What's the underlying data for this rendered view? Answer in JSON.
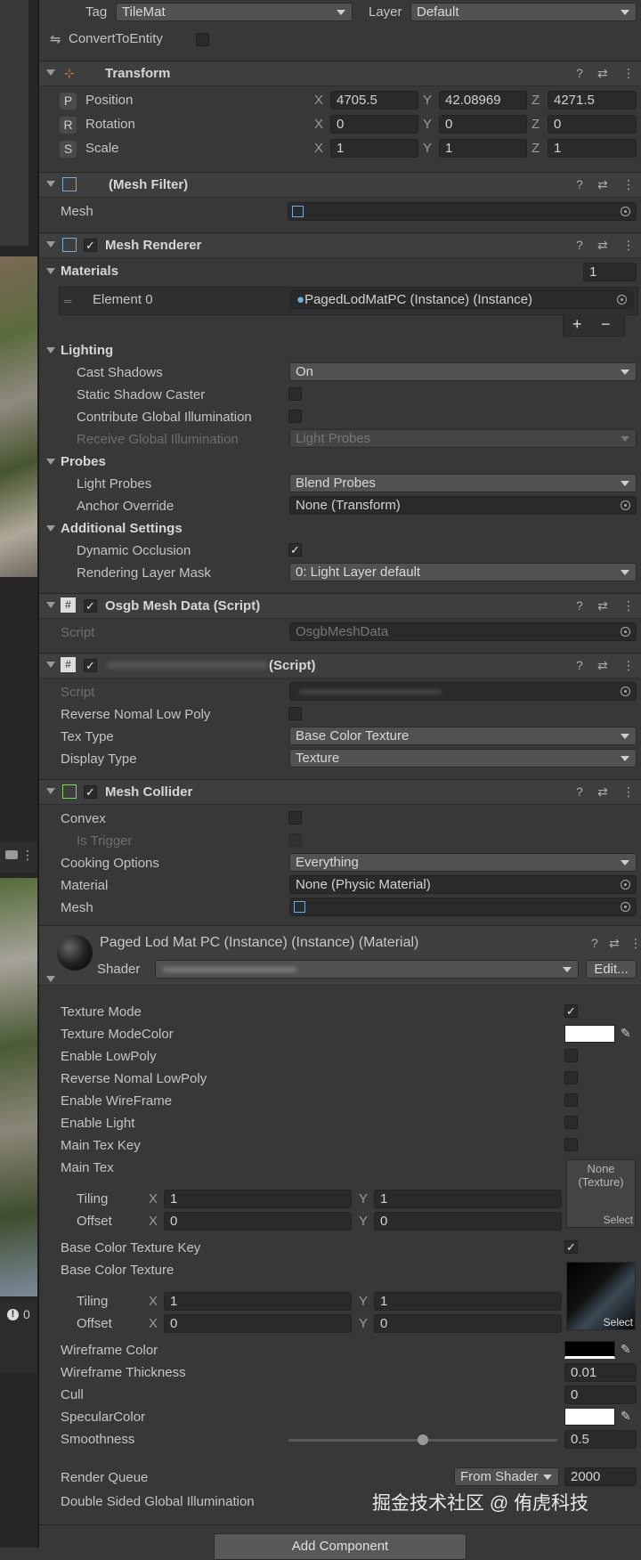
{
  "top": {
    "tag_label": "Tag",
    "tag_value": "TileMat",
    "layer_label": "Layer",
    "layer_value": "Default",
    "convert_label": "ConvertToEntity"
  },
  "transform": {
    "title": "Transform",
    "rows": [
      {
        "badge": "P",
        "label": "Position",
        "x": "4705.5",
        "y": "42.08969",
        "z": "4271.5"
      },
      {
        "badge": "R",
        "label": "Rotation",
        "x": "0",
        "y": "0",
        "z": "0"
      },
      {
        "badge": "S",
        "label": "Scale",
        "x": "1",
        "y": "1",
        "z": "1"
      }
    ],
    "axis": {
      "x": "X",
      "y": "Y",
      "z": "Z"
    }
  },
  "mesh_filter": {
    "title": "(Mesh Filter)",
    "mesh_label": "Mesh"
  },
  "mesh_renderer": {
    "title": "Mesh Renderer",
    "materials_label": "Materials",
    "materials_count": "1",
    "element_label": "Element 0",
    "element_value": "PagedLodMatPC (Instance) (Instance)",
    "plus": "+",
    "minus": "−",
    "lighting_label": "Lighting",
    "cast_shadows_label": "Cast Shadows",
    "cast_shadows_value": "On",
    "static_shadow_label": "Static Shadow Caster",
    "contribute_gi_label": "Contribute Global Illumination",
    "receive_gi_label": "Receive Global Illumination",
    "receive_gi_value": "Light Probes",
    "probes_label": "Probes",
    "light_probes_label": "Light Probes",
    "light_probes_value": "Blend Probes",
    "anchor_label": "Anchor Override",
    "anchor_value": "None (Transform)",
    "additional_label": "Additional Settings",
    "dynamic_occlusion_label": "Dynamic Occlusion",
    "rendering_layer_label": "Rendering Layer Mask",
    "rendering_layer_value": "0: Light Layer default"
  },
  "osgb_script": {
    "title": "Osgb Mesh Data (Script)",
    "script_label": "Script",
    "script_value": "OsgbMeshData"
  },
  "custom_script": {
    "title": "(Script)",
    "script_label": "Script",
    "reverse_label": "Reverse Nomal Low Poly",
    "tex_type_label": "Tex Type",
    "tex_type_value": "Base Color Texture",
    "display_type_label": "Display Type",
    "display_type_value": "Texture"
  },
  "mesh_collider": {
    "title": "Mesh Collider",
    "convex_label": "Convex",
    "trigger_label": "Is Trigger",
    "cooking_label": "Cooking Options",
    "cooking_value": "Everything",
    "material_label": "Material",
    "material_value": "None (Physic Material)",
    "mesh_label": "Mesh"
  },
  "material": {
    "title": "Paged Lod Mat PC (Instance) (Instance) (Material)",
    "shader_label": "Shader",
    "edit_label": "Edit...",
    "props": {
      "texture_mode": "Texture Mode",
      "texture_mode_color": "Texture ModeColor",
      "enable_lowpoly": "Enable LowPoly",
      "reverse_lowpoly": "Reverse Nomal LowPoly",
      "enable_wireframe": "Enable WireFrame",
      "enable_light": "Enable Light",
      "main_tex_key": "Main Tex Key",
      "main_tex": "Main Tex",
      "tiling": "Tiling",
      "offset": "Offset",
      "base_color_key": "Base Color Texture Key",
      "base_color_tex": "Base Color Texture",
      "wireframe_color": "Wireframe Color",
      "wireframe_thickness": "Wireframe Thickness",
      "cull": "Cull",
      "specular_color": "SpecularColor",
      "smoothness": "Smoothness",
      "render_queue": "Render Queue",
      "double_sided_gi": "Double Sided Global Illumination"
    },
    "main_tex_tiling": {
      "x": "1",
      "y": "1"
    },
    "main_tex_offset": {
      "x": "0",
      "y": "0"
    },
    "base_tiling": {
      "x": "1",
      "y": "1"
    },
    "base_offset": {
      "x": "0",
      "y": "0"
    },
    "none_texture": "None\n(Texture)",
    "select": "Select",
    "wireframe_thickness_value": "0.01",
    "cull_value": "0",
    "smoothness_value": "0.5",
    "smoothness_fraction": 0.5,
    "render_queue_mode": "From Shader",
    "render_queue_value": "2000"
  },
  "add_component": "Add Component",
  "watermark": "掘金技术社区 @ 侑虎科技",
  "left": {
    "warning_count": "0"
  },
  "colors": {
    "panel": "#383838",
    "header": "#3e3e3e",
    "field": "#2a2a2a",
    "dropdown": "#515151"
  }
}
